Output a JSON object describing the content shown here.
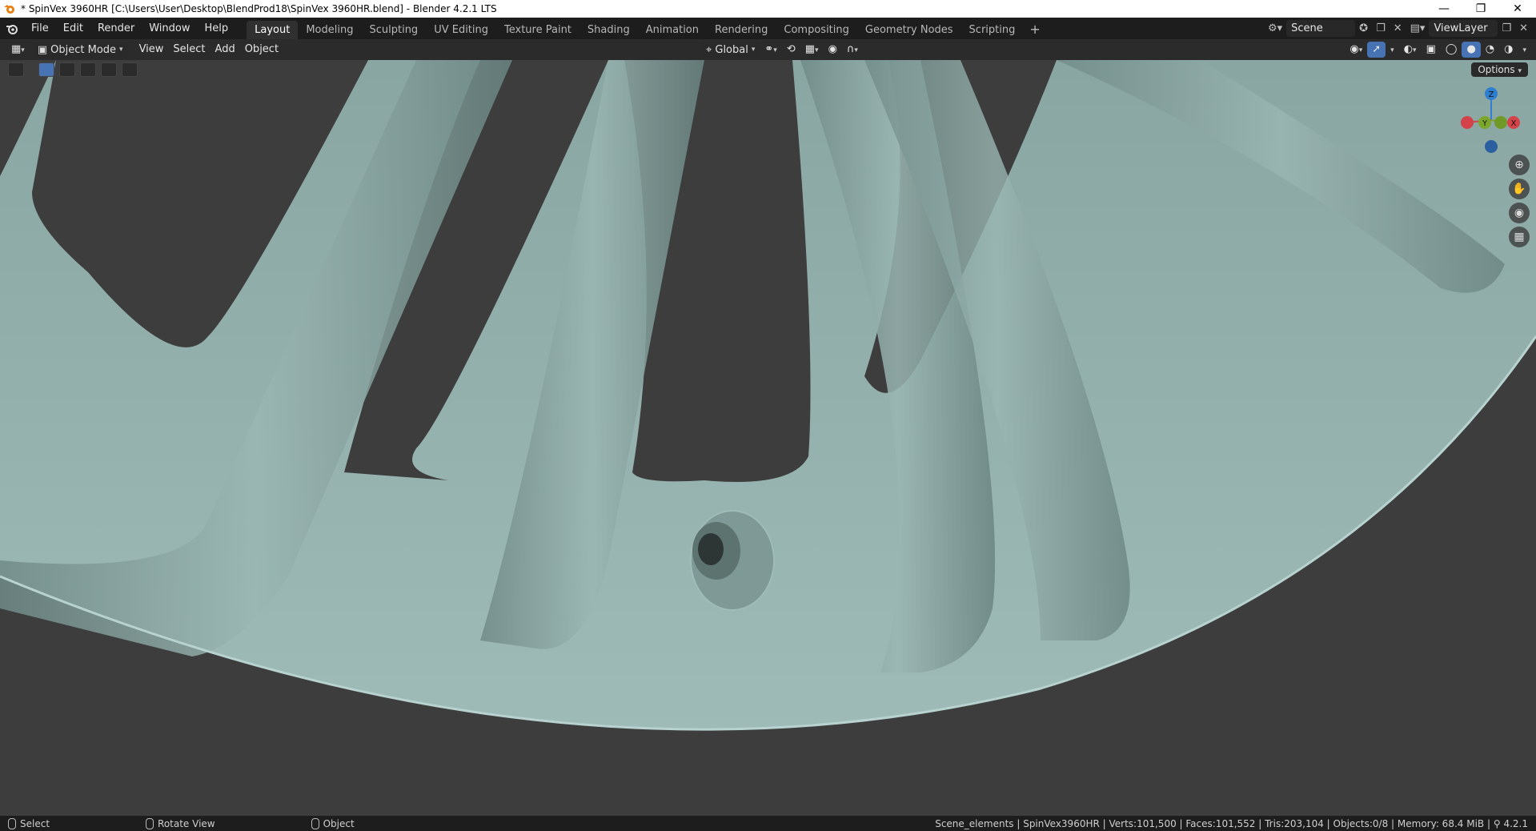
{
  "window": {
    "title": "* SpinVex 3960HR [C:\\Users\\User\\Desktop\\BlendProd18\\SpinVex 3960HR.blend] - Blender 4.2.1 LTS",
    "controls": [
      "—",
      "❐",
      "✕"
    ]
  },
  "menu": [
    "File",
    "Edit",
    "Render",
    "Window",
    "Help"
  ],
  "workspaces": [
    "Layout",
    "Modeling",
    "Sculpting",
    "UV Editing",
    "Texture Paint",
    "Shading",
    "Animation",
    "Rendering",
    "Compositing",
    "Geometry Nodes",
    "Scripting"
  ],
  "active_workspace": "Layout",
  "scene": {
    "name": "Scene",
    "view_layer": "ViewLayer"
  },
  "header": {
    "mode": "Object Mode",
    "items": [
      "View",
      "Select",
      "Add",
      "Object"
    ],
    "orientation": "Global"
  },
  "viewport": {
    "options_label": "Options",
    "gizmo": {
      "z": "Z",
      "y": "Y",
      "x": "X"
    },
    "colors": {
      "background": "#3d3d3d",
      "mesh": "#86a19e",
      "axis_x": "#d4434a",
      "axis_y": "#7ba72c",
      "axis_z": "#2f7fd1"
    }
  },
  "status": {
    "hints": [
      "Select",
      "Rotate View",
      "Object"
    ],
    "info": "Scene_elements | SpinVex3960HR | Verts:101,500 | Faces:101,552 | Tris:203,104 | Objects:0/8 | Memory: 68.4 MiB |",
    "version": "4.2.1"
  }
}
